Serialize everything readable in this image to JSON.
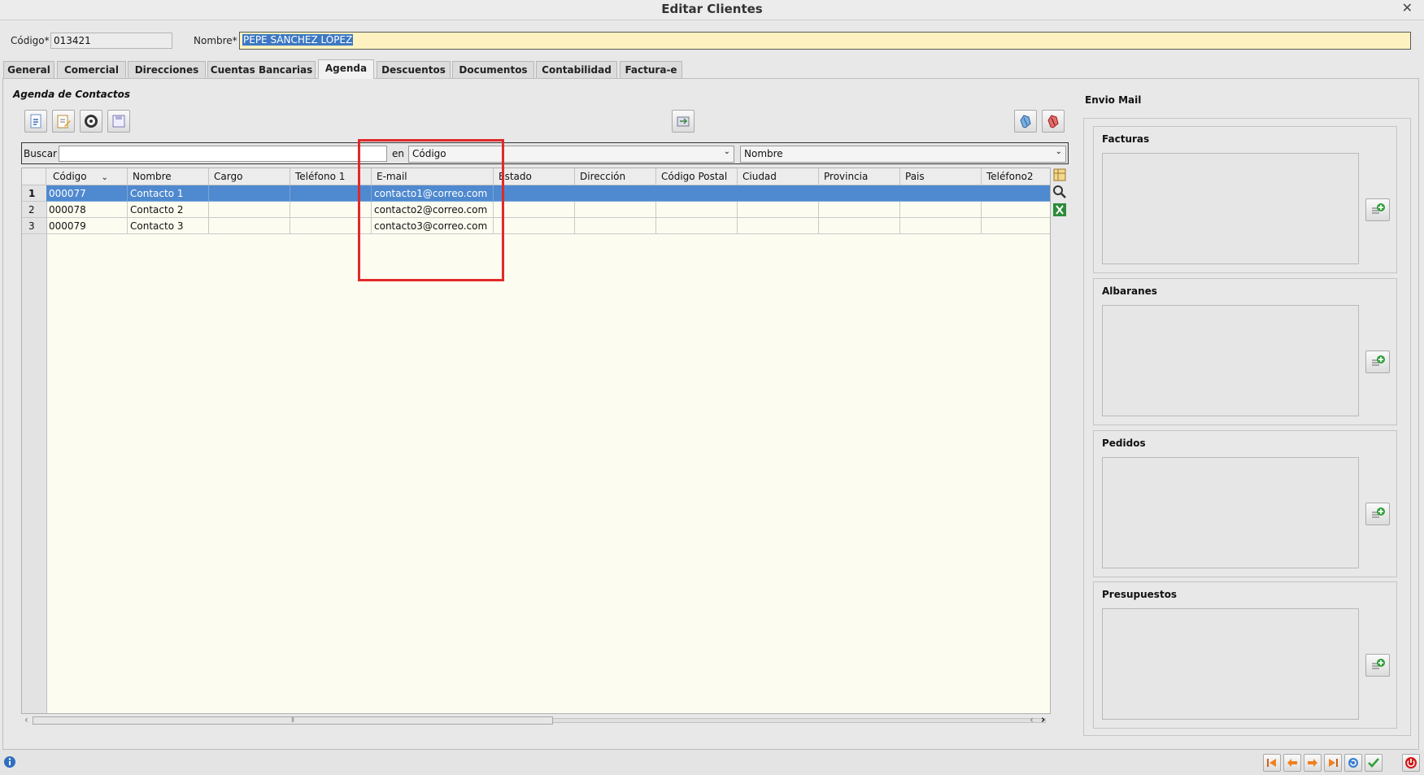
{
  "window": {
    "title": "Editar Clientes",
    "close_glyph": "✕"
  },
  "header": {
    "codigo_label": "Código*",
    "codigo_value": "013421",
    "nombre_label": "Nombre*",
    "nombre_value": "PEPE SÁNCHEZ LÓPEZ"
  },
  "tabs": [
    {
      "label": "General"
    },
    {
      "label": "Comercial"
    },
    {
      "label": "Direcciones"
    },
    {
      "label": "Cuentas Bancarias"
    },
    {
      "label": "Agenda",
      "active": true
    },
    {
      "label": "Descuentos"
    },
    {
      "label": "Documentos"
    },
    {
      "label": "Contabilidad"
    },
    {
      "label": "Factura-e"
    }
  ],
  "agenda": {
    "section_title": "Agenda de Contactos",
    "toolbar_icons": [
      "new-record-icon",
      "edit-record-icon",
      "contacts-icon",
      "save-icon",
      "import-icon",
      "attach-blue-icon",
      "attach-red-icon"
    ],
    "search": {
      "label": "Buscar",
      "value": "",
      "in_label": "en",
      "field_select": "Código",
      "order_select": "Nombre"
    },
    "columns": [
      "Código",
      "Nombre",
      "Cargo",
      "Teléfono 1",
      "E-mail",
      "Estado",
      "Dirección",
      "Código Postal",
      "Ciudad",
      "Provincia",
      "Pais",
      "Teléfono2"
    ],
    "rows": [
      {
        "n": "1",
        "codigo": "000077",
        "nombre": "Contacto 1",
        "email": "contacto1@correo.com",
        "selected": true
      },
      {
        "n": "2",
        "codigo": "000078",
        "nombre": "Contacto 2",
        "email": "contacto2@correo.com"
      },
      {
        "n": "3",
        "codigo": "000079",
        "nombre": "Contacto 3",
        "email": "contacto3@correo.com"
      }
    ],
    "scroll_grip": "⦀"
  },
  "envio_mail": {
    "title": "Envio Mail",
    "groups": [
      {
        "title": "Facturas"
      },
      {
        "title": "Albaranes"
      },
      {
        "title": "Pedidos"
      },
      {
        "title": "Presupuestos"
      }
    ]
  },
  "colors": {
    "selection": "#4f89cf",
    "highlight_box": "#e02a2a",
    "name_field_bg": "#fdf2c0"
  }
}
